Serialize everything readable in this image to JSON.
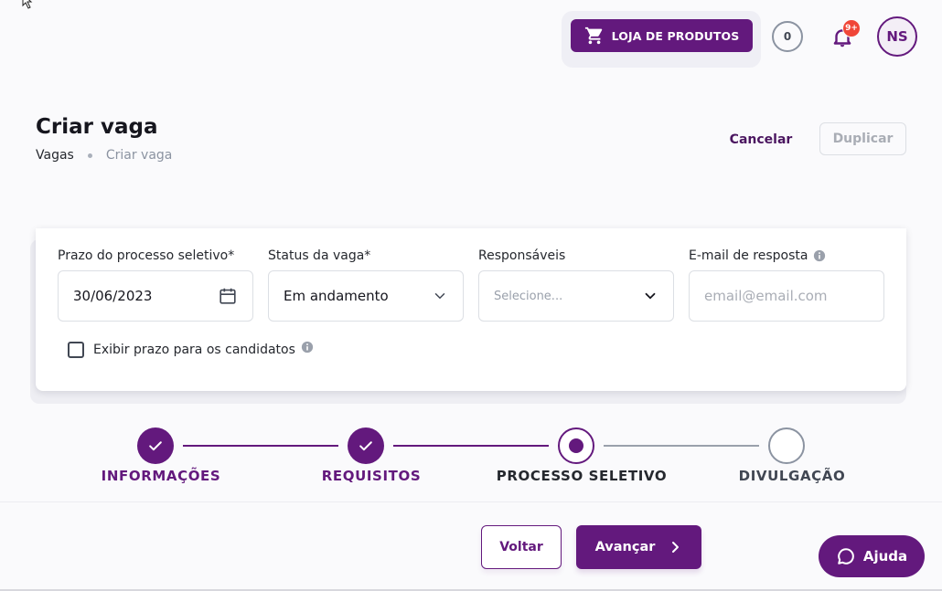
{
  "header": {
    "store_button": "LOJA DE PRODUTOS",
    "counter": "0",
    "notification_badge": "9+",
    "avatar_initials": "NS"
  },
  "page": {
    "title": "Criar vaga",
    "breadcrumb": [
      "Vagas",
      "Criar vaga"
    ],
    "cancel_label": "Cancelar",
    "duplicate_label": "Duplicar"
  },
  "form": {
    "deadline": {
      "label": "Prazo do processo seletivo*",
      "value": "30/06/2023"
    },
    "status": {
      "label": "Status da vaga*",
      "value": "Em andamento"
    },
    "owners": {
      "label": "Responsáveis",
      "placeholder": "Selecione..."
    },
    "reply_email": {
      "label": "E-mail de resposta",
      "placeholder": "email@email.com"
    },
    "show_deadline": {
      "label": "Exibir prazo para os candidatos",
      "checked": false
    }
  },
  "stepper": {
    "steps": [
      {
        "label": "INFORMAÇÕES",
        "state": "done"
      },
      {
        "label": "REQUISITOS",
        "state": "done"
      },
      {
        "label": "PROCESSO SELETIVO",
        "state": "current"
      },
      {
        "label": "DIVULGAÇÃO",
        "state": "todo"
      }
    ]
  },
  "footer": {
    "back_label": "Voltar",
    "next_label": "Avançar",
    "help_label": "Ajuda"
  },
  "colors": {
    "primary": "#63197d",
    "done_label": "#63197d",
    "current_label": "#25282e",
    "todo_label": "#414753",
    "badge": "#f04638"
  }
}
